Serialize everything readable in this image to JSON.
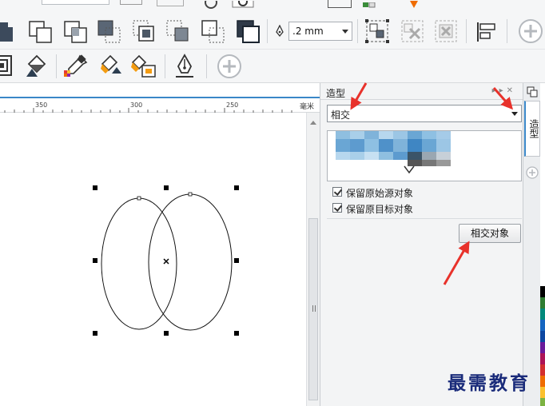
{
  "toolbar": {
    "outline_width": ".2 mm",
    "buttons_row1": [
      "weld",
      "trim",
      "intersect",
      "simplify",
      "front-minus-back",
      "back-minus-front",
      "create-boundary",
      "group-objects",
      "ungroup",
      "ungroup-all",
      "align-distribute",
      "add-button"
    ],
    "buttons_row2": [
      "contour",
      "fill-bucket",
      "eyedropper",
      "attributes-eyedropper",
      "smart-fill",
      "pen-tool",
      "add-button"
    ]
  },
  "ruler": {
    "labels": [
      "350",
      "300",
      "250"
    ],
    "unit": "毫米"
  },
  "docker": {
    "title": "造型",
    "shape_operation": "相交",
    "options": [
      {
        "label": "保留原始源对象",
        "checked": true
      },
      {
        "label": "保留原目标对象",
        "checked": true
      }
    ],
    "apply_button": "相交对象"
  },
  "tabs": {
    "shaping": "造型"
  },
  "palette": {
    "colors": [
      "#ffffff",
      "#000000",
      "#2e7d32",
      "#00897b",
      "#1565c0",
      "#0d47a1",
      "#6a1b9a",
      "#ad1457",
      "#d32f2f",
      "#ef6c00",
      "#fbc02d",
      "#7cb342"
    ]
  },
  "watermark": "最需教育"
}
